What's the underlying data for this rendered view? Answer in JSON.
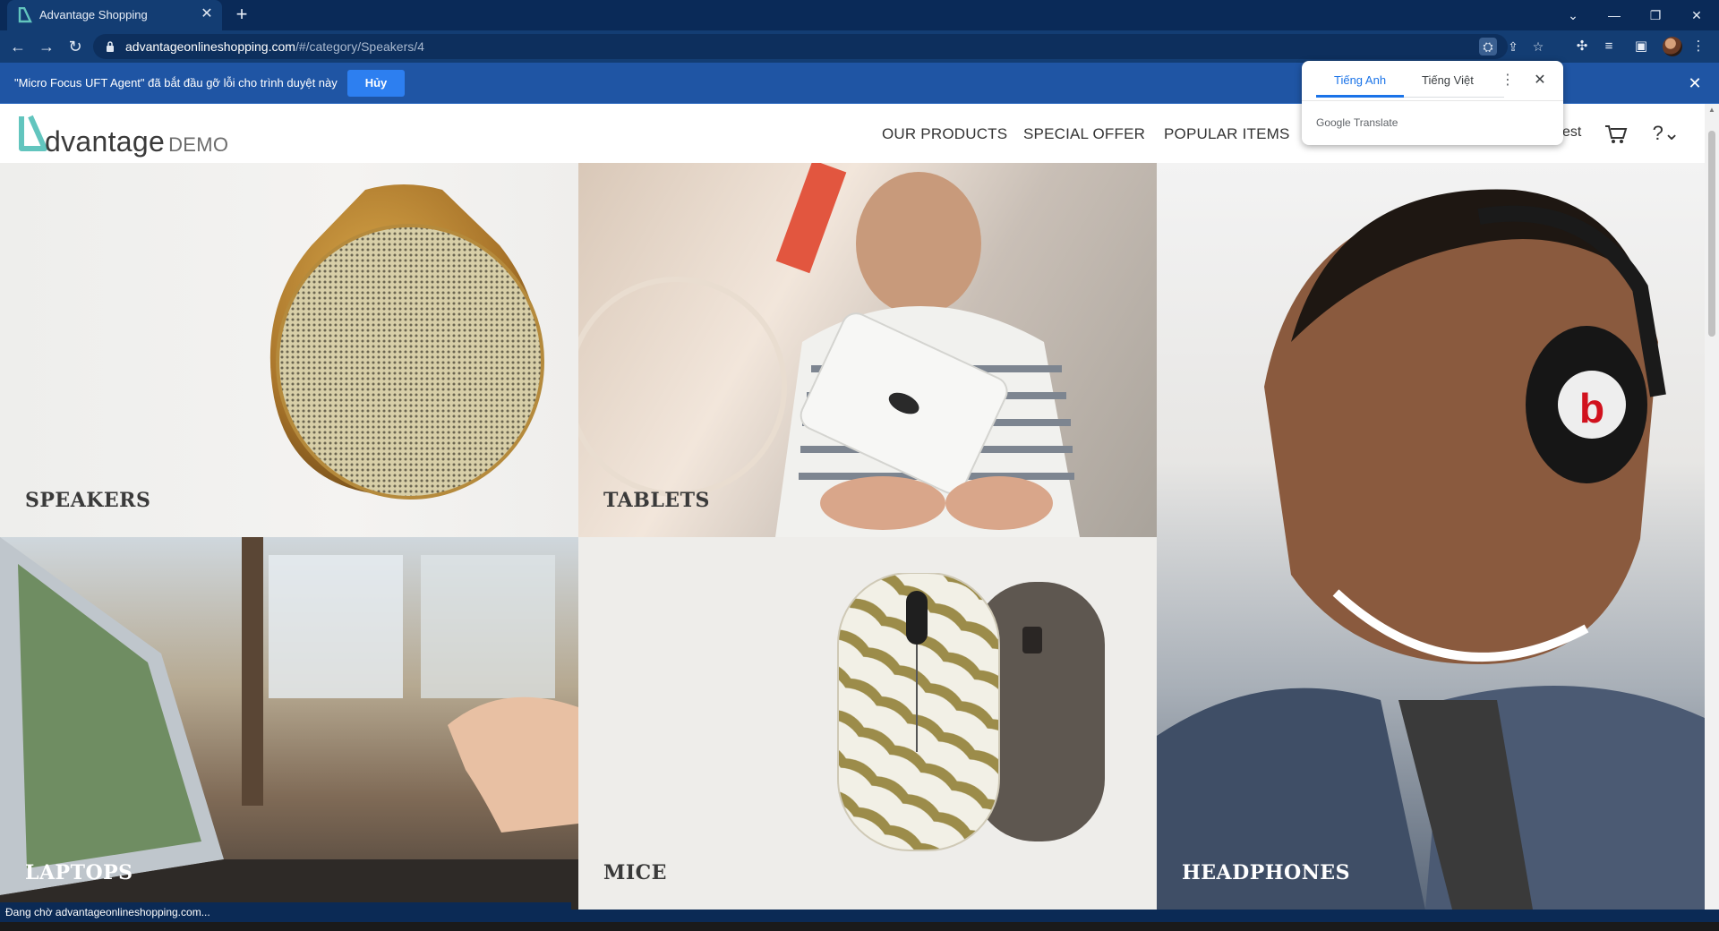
{
  "browser": {
    "tab_title": "Advantage Shopping",
    "tab_close": "✕",
    "new_tab": "+",
    "url_host": "advantageonlineshopping.com",
    "url_path": "/#/category/Speakers/4",
    "window_controls": [
      "⌄",
      "—",
      "❐",
      "✕"
    ]
  },
  "infobar": {
    "message": "\"Micro Focus UFT Agent\" đã bắt đầu gỡ lỗi cho trình duyệt này",
    "cancel_label": "Hủy",
    "close": "✕"
  },
  "translate_popup": {
    "tab_source": "Tiếng Anh",
    "tab_target": "Tiếng Việt",
    "more": "⋮",
    "close": "✕",
    "brand": "Google Translate"
  },
  "site": {
    "logo_main": "dvantage",
    "logo_demo": "DEMO",
    "nav": [
      "OUR PRODUCTS",
      "SPECIAL OFFER",
      "POPULAR ITEMS"
    ],
    "partial_text": "est",
    "accent_color": "#62c5be"
  },
  "categories": {
    "speakers": "SPEAKERS",
    "tablets": "TABLETS",
    "laptops": "LAPTOPS",
    "mice": "MICE",
    "headphones": "HEADPHONES"
  },
  "status": {
    "text": "Đang chờ advantageonlineshopping.com..."
  }
}
